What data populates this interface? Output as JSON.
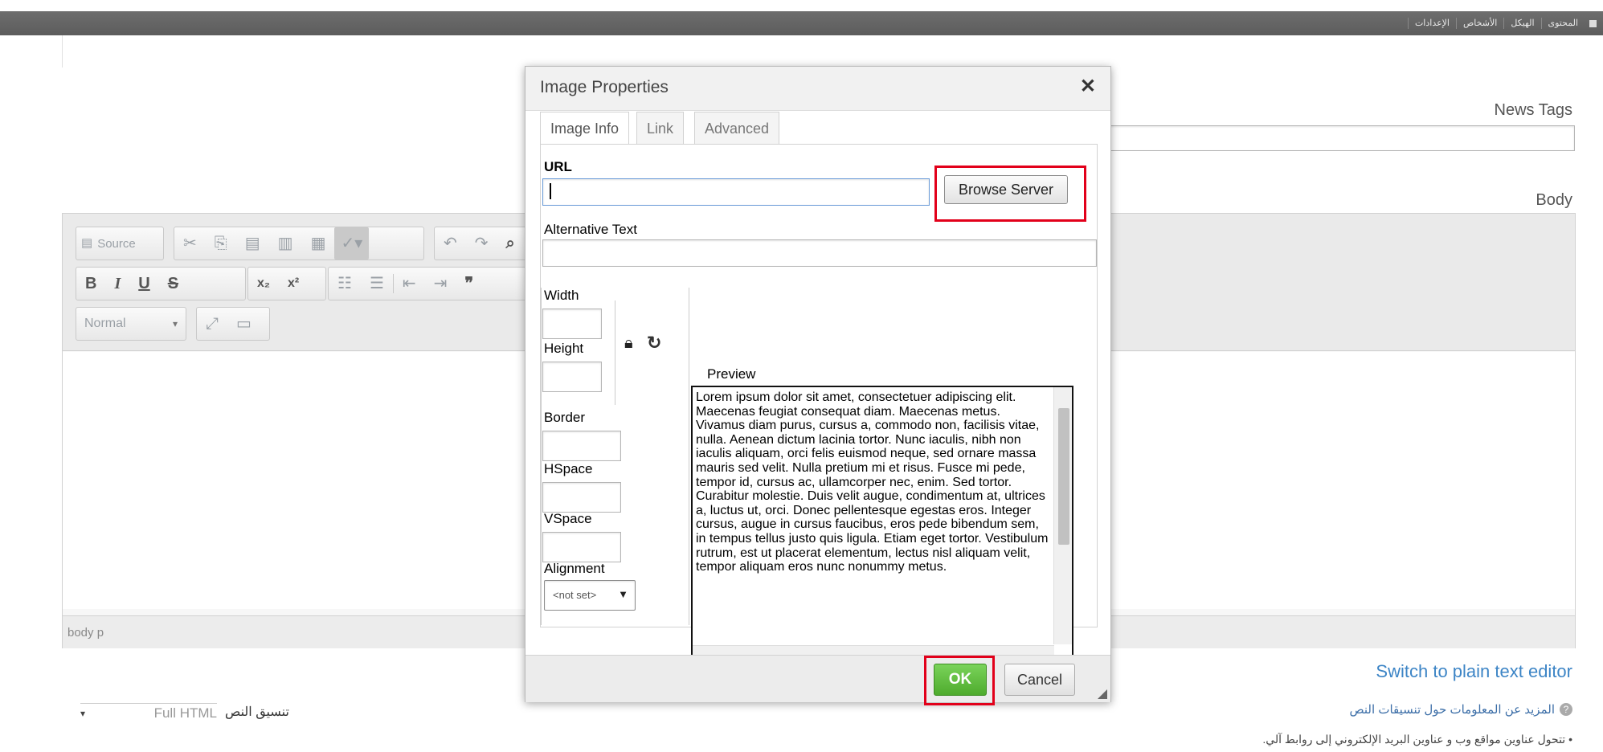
{
  "top_nav": [
    "المحتوى",
    "الهيكل",
    "الأشخاص",
    "الإعدادات"
  ],
  "news_tags_label": "News Tags",
  "body_label": "Body",
  "editor": {
    "source_label": "Source",
    "format_value": "Normal",
    "path": "body  p",
    "switch_link": "Switch to plain text editor"
  },
  "text_format": {
    "label": "تنسيق النص",
    "value": "Full HTML"
  },
  "help_link": "المزيد عن المعلومات حول تنسيقات النص",
  "help_item": "تتحول عناوين مواقع وب و عناوين البريد الإلكتروني إلى روابط آلي.",
  "dialog": {
    "title": "Image Properties",
    "close_icon": "close-icon",
    "tabs": [
      "Image Info",
      "Link",
      "Advanced"
    ],
    "url_label": "URL",
    "url_value": "",
    "browse_label": "Browse Server",
    "alt_label": "Alternative Text",
    "alt_value": "",
    "width_label": "Width",
    "height_label": "Height",
    "border_label": "Border",
    "hspace_label": "HSpace",
    "vspace_label": "VSpace",
    "alignment_label": "Alignment",
    "alignment_value": "<not set>",
    "preview_label": "Preview",
    "preview_text": "Lorem ipsum dolor sit amet, consectetuer adipiscing elit. Maecenas feugiat consequat diam. Maecenas metus. Vivamus diam purus, cursus a, commodo non, facilisis vitae, nulla. Aenean dictum lacinia tortor. Nunc iaculis, nibh non iaculis aliquam, orci felis euismod neque, sed ornare massa mauris sed velit. Nulla pretium mi et risus. Fusce mi pede, tempor id, cursus ac, ullamcorper nec, enim. Sed tortor. Curabitur molestie. Duis velit augue, condimentum at, ultrices a, luctus ut, orci. Donec pellentesque egestas eros. Integer cursus, augue in cursus faucibus, eros pede bibendum sem, in tempus tellus justo quis ligula. Etiam eget tortor. Vestibulum rutrum, est ut placerat elementum, lectus nisl aliquam velit, tempor aliquam eros nunc nonummy metus.",
    "ok_label": "OK",
    "cancel_label": "Cancel"
  },
  "colors": {
    "ok_green": "#58b43a",
    "highlight_red": "#e2001a",
    "topbar": "#666666"
  }
}
